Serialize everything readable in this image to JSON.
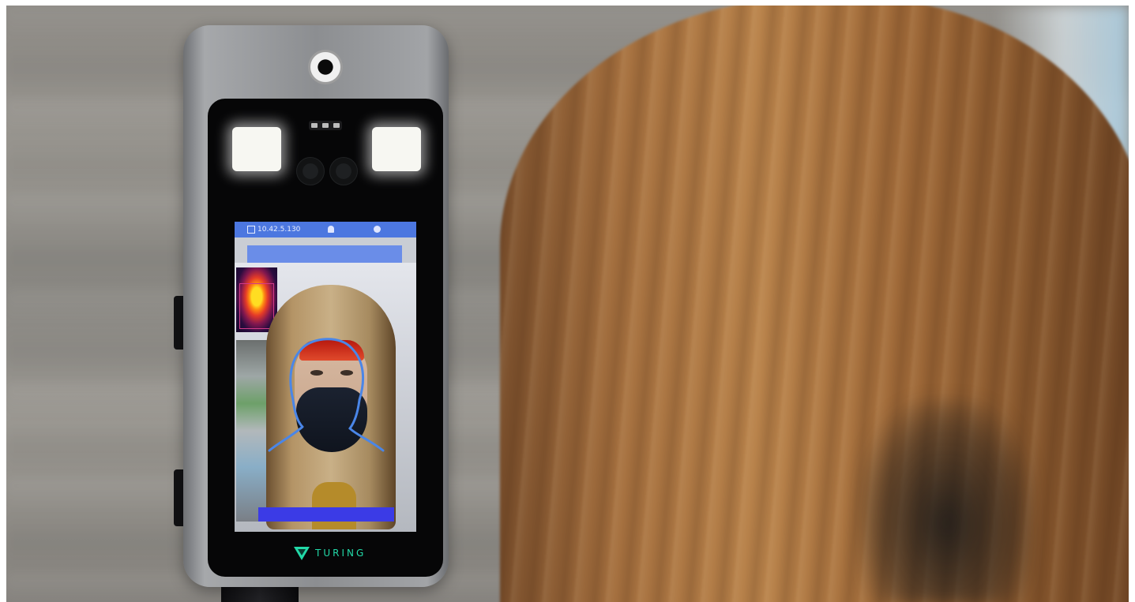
{
  "screen": {
    "ip_address": "10.42.5.130",
    "alert_text": "",
    "time_text": ""
  },
  "brand": {
    "name": "TURING",
    "color": "#22d9a8"
  },
  "icons": {
    "status_ip": "monitor-icon",
    "status_user": "user-icon",
    "status_settings": "gear-icon",
    "brand": "turing-logo-icon"
  },
  "colors": {
    "status_bar": "#4c77e0",
    "alert_bar": "#3b3be6",
    "alert_text": "#ff2a48",
    "face_outline": "#4a86e8",
    "forehead_heat": "#d8261a"
  }
}
